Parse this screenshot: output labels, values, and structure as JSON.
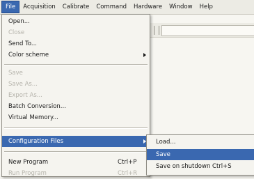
{
  "menubar": {
    "items": [
      "File",
      "Acquisition",
      "Calibrate",
      "Command",
      "Hardware",
      "Window",
      "Help"
    ]
  },
  "file_menu": {
    "items": [
      {
        "label": "Open...",
        "shortcut": "",
        "enabled": true,
        "has_submenu": false
      },
      {
        "label": "Close",
        "shortcut": "",
        "enabled": false,
        "has_submenu": false
      },
      {
        "label": "Send To...",
        "shortcut": "",
        "enabled": true,
        "has_submenu": false
      },
      {
        "label": "Color scheme",
        "shortcut": "",
        "enabled": true,
        "has_submenu": true
      },
      {
        "label": "Save",
        "shortcut": "",
        "enabled": false,
        "has_submenu": false
      },
      {
        "label": "Save As...",
        "shortcut": "",
        "enabled": false,
        "has_submenu": false
      },
      {
        "label": "Export As...",
        "shortcut": "",
        "enabled": false,
        "has_submenu": false
      },
      {
        "label": "Batch Conversion...",
        "shortcut": "",
        "enabled": true,
        "has_submenu": false
      },
      {
        "label": "Virtual Memory...",
        "shortcut": "",
        "enabled": true,
        "has_submenu": false
      },
      {
        "label": "Configuration Files",
        "shortcut": "",
        "enabled": true,
        "has_submenu": true,
        "highlighted": true
      },
      {
        "label": "New Program",
        "shortcut": "Ctrl+P",
        "enabled": true,
        "has_submenu": false
      },
      {
        "label": "Run Program",
        "shortcut": "Ctrl+R",
        "enabled": false,
        "has_submenu": false
      }
    ]
  },
  "config_submenu": {
    "items": [
      {
        "label": "Load...",
        "enabled": true,
        "highlighted": false
      },
      {
        "label": "Save",
        "enabled": true,
        "highlighted": true
      },
      {
        "label": "Save on shutdown  Ctrl+S",
        "enabled": true,
        "highlighted": false
      }
    ]
  },
  "colors": {
    "highlight": "#3a68b0",
    "menu_background": "#f5f4ef",
    "disabled_text": "#b5b3ab"
  }
}
